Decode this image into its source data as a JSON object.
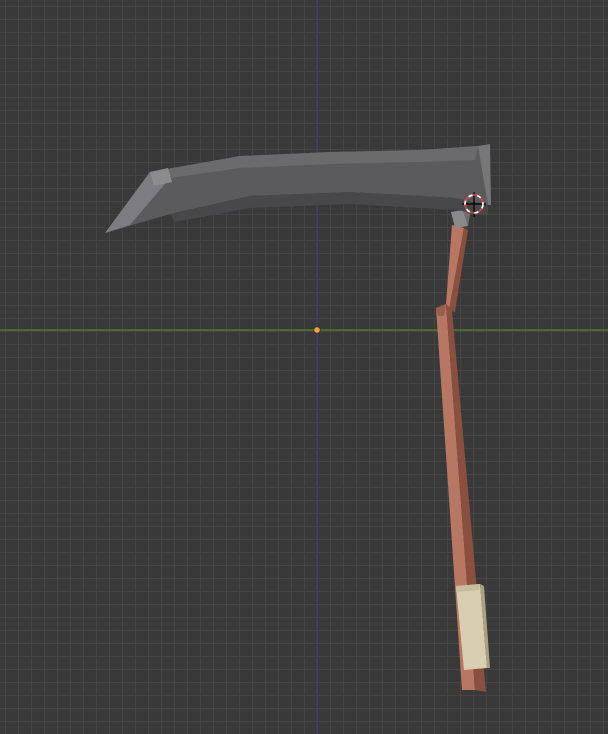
{
  "viewport": {
    "background_color": "#393939",
    "grid_color": "#444444",
    "axis_x_color": "#4e8a2c",
    "axis_y_color": "#3a3a80",
    "origin_color": "#e8a040"
  },
  "scene": {
    "objects": [
      {
        "name": "scythe",
        "parts": [
          "blade",
          "tang",
          "shaft",
          "grip"
        ],
        "colors": {
          "blade": "#5a5a5e",
          "shaft": "#a86a52",
          "grip": "#d8cfb0",
          "tang": "#8a8a8a"
        }
      }
    ],
    "cursor_3d": {
      "outer_color": "#d94040",
      "inner_color": "#ffffff",
      "crosshair_color": "#000000"
    }
  }
}
